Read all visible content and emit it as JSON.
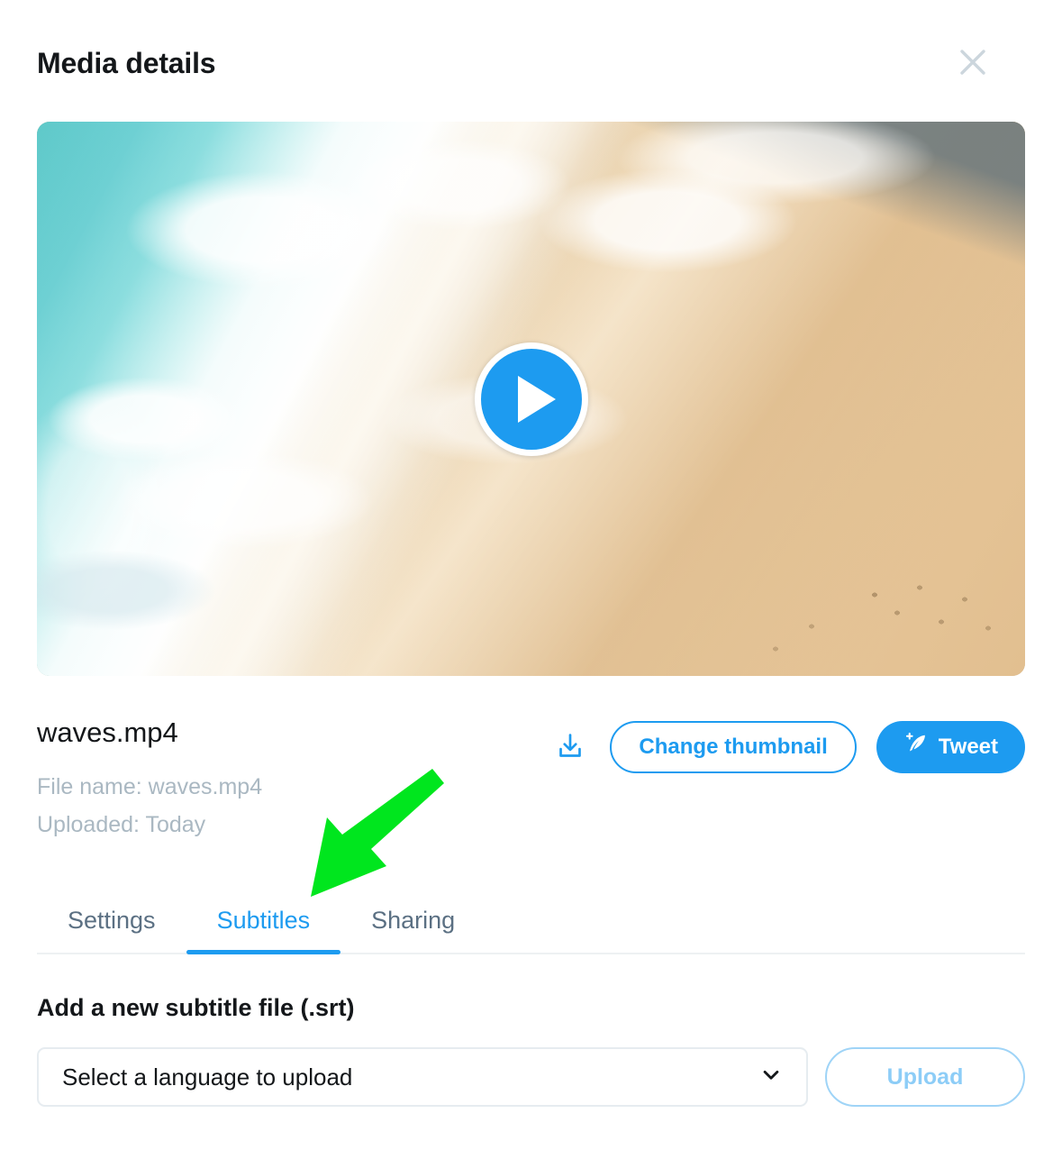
{
  "dialog": {
    "title": "Media details",
    "close_icon": "close-icon"
  },
  "video": {
    "play_icon": "play-icon",
    "thumbnail_description": "Aerial view of turquoise ocean waves washing onto tan sand beach"
  },
  "media_info": {
    "file_title": "waves.mp4",
    "file_name_line": "File name: waves.mp4",
    "uploaded_line": "Uploaded: Today"
  },
  "actions": {
    "download_icon": "download-icon",
    "change_thumbnail_label": "Change thumbnail",
    "tweet_label": "Tweet",
    "tweet_icon": "feather-compose-icon"
  },
  "tabs": [
    {
      "label": "Settings",
      "active": false
    },
    {
      "label": "Subtitles",
      "active": true
    },
    {
      "label": "Sharing",
      "active": false
    }
  ],
  "subtitles_panel": {
    "heading": "Add a new subtitle file (.srt)",
    "select_value": "Select a language to upload",
    "select_placeholder": "Select a language to upload",
    "chevron_icon": "chevron-down-icon",
    "upload_label": "Upload"
  },
  "annotation": {
    "type": "arrow",
    "color": "#00e61e",
    "points_to": "Subtitles"
  },
  "colors": {
    "accent_blue": "#1d9bf0",
    "upload_disabled_blue": "#8dcdf7",
    "text_primary": "#14171a",
    "text_muted": "#aab8c2",
    "tab_inactive": "#5b7083",
    "border": "#e6ecf0",
    "annotation_green": "#00e61e"
  }
}
